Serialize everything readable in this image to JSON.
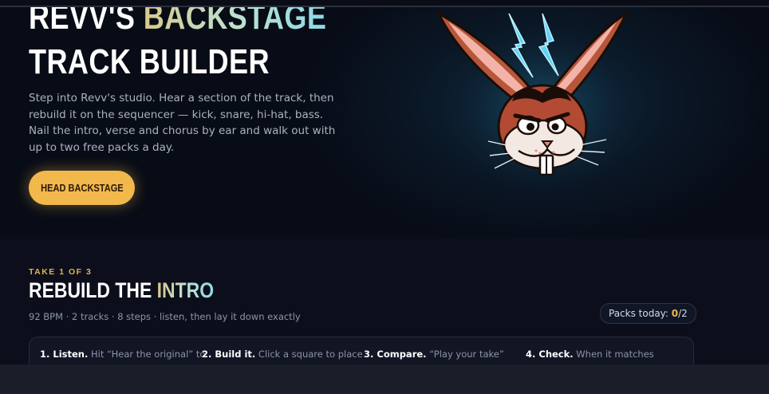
{
  "hero": {
    "title_line1_a": "REVV'S ",
    "title_line1_b": "BACKSTAGE",
    "title_line2": "TRACK BUILDER",
    "description": "Step into Revv's studio. Hear a section of the track, then rebuild it on the sequencer — kick, snare, hi-hat, bass. Nail the intro, verse and chorus by ear and walk out with up to two free packs a day.",
    "cta_label": "HEAD BACKSTAGE",
    "mascot_icon": "rabbit-mascot-icon"
  },
  "section": {
    "take_label": "TAKE 1 OF 3",
    "title_a": "REBUILD THE ",
    "title_b": "INTRO",
    "subtitle": "92 BPM · 2 tracks · 8 steps · listen, then lay it down exactly",
    "packs_label": "Packs today: ",
    "packs_used": "0",
    "packs_total": "/2"
  },
  "steps": [
    {
      "title": "1. Listen.",
      "text": " Hit “Hear the original” to"
    },
    {
      "title": "2. Build it.",
      "text": " Click a square to place"
    },
    {
      "title": "3. Compare.",
      "text": " “Play your take”"
    },
    {
      "title": "4. Check.",
      "text": " When it matches"
    }
  ],
  "colors": {
    "accent": "#f2b84c",
    "background": "#0a0d16",
    "electric": "#5fd3f5"
  }
}
